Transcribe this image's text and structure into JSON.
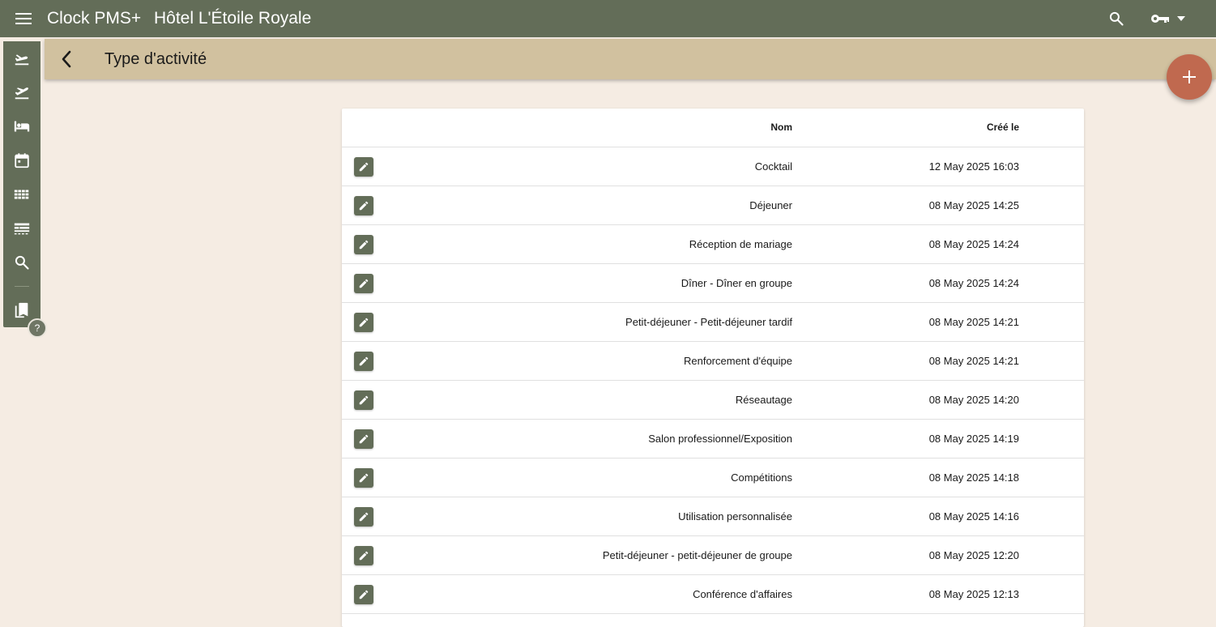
{
  "topbar": {
    "app_name": "Clock PMS+",
    "hotel_name": "Hôtel L'Étoile Royale",
    "icons": [
      "menu-icon",
      "search-icon",
      "key-icon",
      "caret-down-icon"
    ]
  },
  "rail": {
    "icons": [
      "arrivals-icon",
      "departures-icon",
      "bed-icon",
      "calendar-icon",
      "grid-icon",
      "table-view-icon",
      "search-icon",
      "bookmarks-icon",
      "help-icon"
    ],
    "help_label": "?"
  },
  "subheader": {
    "title": "Type d'activité",
    "back_icon": "arrow-back-icon"
  },
  "fab": {
    "icon": "plus-icon"
  },
  "table": {
    "columns": {
      "nom": "Nom",
      "cree": "Créé le"
    },
    "rows": [
      {
        "nom": "Cocktail",
        "cree": "12 May 2025 16:03"
      },
      {
        "nom": "Déjeuner",
        "cree": "08 May 2025 14:25"
      },
      {
        "nom": "Réception de mariage",
        "cree": "08 May 2025 14:24"
      },
      {
        "nom": "Dîner - Dîner en groupe",
        "cree": "08 May 2025 14:24"
      },
      {
        "nom": "Petit-déjeuner - Petit-déjeuner tardif",
        "cree": "08 May 2025 14:21"
      },
      {
        "nom": "Renforcement d'équipe",
        "cree": "08 May 2025 14:21"
      },
      {
        "nom": "Réseautage",
        "cree": "08 May 2025 14:20"
      },
      {
        "nom": "Salon professionnel/Exposition",
        "cree": "08 May 2025 14:19"
      },
      {
        "nom": "Compétitions",
        "cree": "08 May 2025 14:18"
      },
      {
        "nom": "Utilisation personnalisée",
        "cree": "08 May 2025 14:16"
      },
      {
        "nom": "Petit-déjeuner - petit-déjeuner de groupe",
        "cree": "08 May 2025 12:20"
      },
      {
        "nom": "Conférence d'affaires",
        "cree": "08 May 2025 12:13"
      }
    ]
  },
  "colors": {
    "topbar": "#636d58",
    "subheader": "#d1c19f",
    "background": "#f5ece3",
    "fab": "#c0694f",
    "edit_button": "#636d58"
  }
}
